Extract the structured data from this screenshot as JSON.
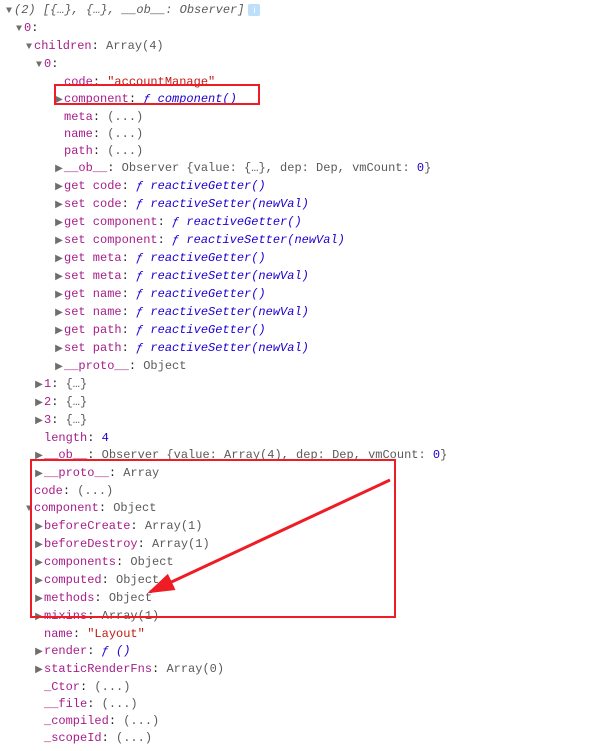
{
  "header": {
    "summary_open": "(2) ",
    "summary_body": "[{…}, {…}, __ob__: Observer]"
  },
  "tree": {
    "idx0": "0",
    "children_key": "children",
    "children_val": "Array(4)",
    "child0": {
      "idx": "0",
      "code_key": "code",
      "code_val": "\"accountManage\"",
      "component_key": "component",
      "component_val_fn": "ƒ component()",
      "meta": {
        "k": "meta",
        "v": "(...)"
      },
      "name": {
        "k": "name",
        "v": "(...)"
      },
      "path": {
        "k": "path",
        "v": "(...)"
      },
      "ob": {
        "k": "__ob__",
        "v": "Observer {value: {…}, dep: Dep, vmCount: ",
        "n": "0",
        "t": "}"
      },
      "getters": [
        {
          "k": "get code",
          "v": "ƒ reactiveGetter()"
        },
        {
          "k": "set code",
          "v": "ƒ reactiveSetter(newVal)"
        },
        {
          "k": "get component",
          "v": "ƒ reactiveGetter()"
        },
        {
          "k": "set component",
          "v": "ƒ reactiveSetter(newVal)"
        },
        {
          "k": "get meta",
          "v": "ƒ reactiveGetter()"
        },
        {
          "k": "set meta",
          "v": "ƒ reactiveSetter(newVal)"
        },
        {
          "k": "get name",
          "v": "ƒ reactiveGetter()"
        },
        {
          "k": "set name",
          "v": "ƒ reactiveSetter(newVal)"
        },
        {
          "k": "get path",
          "v": "ƒ reactiveGetter()"
        },
        {
          "k": "set path",
          "v": "ƒ reactiveSetter(newVal)"
        }
      ],
      "proto": {
        "k": "__proto__",
        "v": "Object"
      }
    },
    "idx1": {
      "k": "1",
      "v": "{…}"
    },
    "idx2": {
      "k": "2",
      "v": "{…}"
    },
    "idx3": {
      "k": "3",
      "v": "{…}"
    },
    "length": {
      "k": "length",
      "v": "4"
    },
    "ob2": {
      "k": "__ob__",
      "v": "Observer {value: Array(4), dep: Dep, vmCount: ",
      "n": "0",
      "t": "}"
    },
    "proto2": {
      "k": "__proto__",
      "v": "Array"
    },
    "code2": {
      "k": "code",
      "v": "(...)"
    },
    "component2": {
      "k": "component",
      "v": "Object",
      "beforeCreate": {
        "k": "beforeCreate",
        "v": "Array(1)"
      },
      "beforeDestroy": {
        "k": "beforeDestroy",
        "v": "Array(1)"
      },
      "components": {
        "k": "components",
        "v": "Object"
      },
      "computed": {
        "k": "computed",
        "v": "Object"
      },
      "methods": {
        "k": "methods",
        "v": "Object"
      },
      "mixins": {
        "k": "mixins",
        "v": "Array(1)"
      },
      "name": {
        "k": "name",
        "v": "\"Layout\""
      },
      "render": {
        "k": "render",
        "v": "ƒ ()"
      },
      "staticRenderFns": {
        "k": "staticRenderFns",
        "v": "Array(0)"
      },
      "ctor": {
        "k": "_Ctor",
        "v": "(...)"
      },
      "file": {
        "k": "__file",
        "v": "(...)"
      },
      "compiled": {
        "k": "_compiled",
        "v": "(...)"
      },
      "scopeId": {
        "k": "_scopeId",
        "v": "(...)"
      }
    }
  }
}
